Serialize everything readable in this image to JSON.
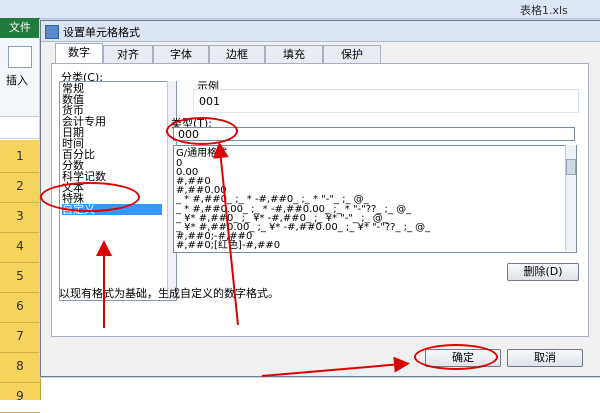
{
  "excel": {
    "file_tab": "文件",
    "insert_label": "插入",
    "window_title": "表格1.xls",
    "row_numbers": [
      "1",
      "2",
      "3",
      "4",
      "5",
      "6",
      "7",
      "8",
      "9"
    ]
  },
  "dialog": {
    "title": "设置单元格格式",
    "tabs": [
      "数字",
      "对齐",
      "字体",
      "边框",
      "填充",
      "保护"
    ],
    "active_tab": "数字",
    "category_label": "分类(C):",
    "categories": [
      "常规",
      "数值",
      "货币",
      "会计专用",
      "日期",
      "时间",
      "百分比",
      "分数",
      "科学记数",
      "文本",
      "特殊",
      "自定义"
    ],
    "selected_category": "自定义",
    "sample_label": "示例",
    "sample_value": "001",
    "type_label": "类型(T):",
    "type_value": "000",
    "format_list": [
      "G/通用格式",
      "0",
      "0.00",
      "#,##0",
      "#,##0.00",
      "_ * #,##0_ ;_ * -#,##0_ ;_ * \"-\"_ ;_ @_",
      "_ * #,##0.00_ ;_ * -#,##0.00_ ;_ * \"-\"??_ ;_ @_",
      "_ ¥* #,##0_ ;_ ¥* -#,##0_ ;_ ¥* \"-\"_ ;_ @_",
      "_ ¥* #,##0.00_ ;_ ¥* -#,##0.00_ ;_ ¥* \"-\"??_ ;_ @_",
      "#,##0;-#,##0",
      "#,##0;[红色]-#,##0"
    ],
    "delete_button": "删除(D)",
    "description": "以现有格式为基础，生成自定义的数字格式。",
    "ok_button": "确定",
    "cancel_button": "取消"
  },
  "colors": {
    "annotation": "#dd0000",
    "selection": "#3399ff",
    "excel_green": "#1f7a3e",
    "row_header": "#f6d35a"
  }
}
